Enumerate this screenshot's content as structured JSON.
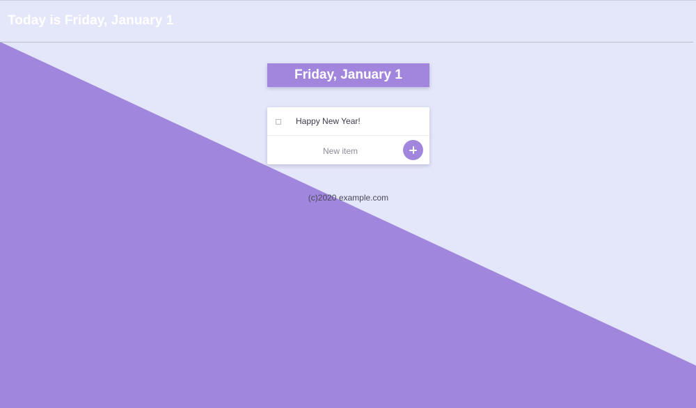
{
  "header": {
    "title": "Today is Friday, January 1"
  },
  "main": {
    "date_banner": "Friday, January 1",
    "todo_items": [
      {
        "text": "Happy New Year!",
        "checked": false
      }
    ],
    "new_item": {
      "placeholder": "New item",
      "value": "",
      "add_icon": "plus-icon"
    }
  },
  "footer": {
    "text": "(c)2020 example.com"
  },
  "colors": {
    "background": "#e4e6fa",
    "accent": "#a286de",
    "text_light": "#ffffff"
  }
}
